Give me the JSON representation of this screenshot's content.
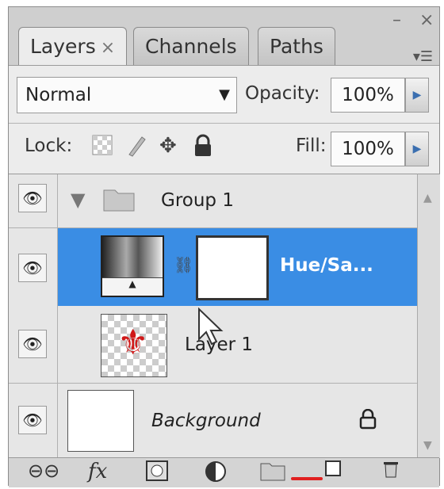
{
  "tabs": [
    {
      "label": "Layers",
      "close": "×"
    },
    {
      "label": "Channels"
    },
    {
      "label": "Paths"
    }
  ],
  "window_controls": {
    "minimize": "–",
    "close": "×",
    "menu": "▾☰"
  },
  "blend_mode": "Normal",
  "opacity": {
    "label": "Opacity:",
    "value": "100%"
  },
  "lock": {
    "label": "Lock:"
  },
  "fill": {
    "label": "Fill:",
    "value": "100%"
  },
  "layers": [
    {
      "name": "Group 1",
      "type": "group"
    },
    {
      "name": "Hue/Sa...",
      "type": "adjustment",
      "selected": true
    },
    {
      "name": "Layer 1",
      "type": "pixel"
    },
    {
      "name": "Background",
      "type": "background",
      "locked": true
    }
  ],
  "icons": {
    "eye": "eye-icon",
    "link": "link-layers-icon",
    "fx": "fx",
    "mask": "add-mask-icon",
    "adjustment": "adjustment-layer-icon",
    "folder": "new-group-icon",
    "new_layer": "new-layer-icon",
    "trash": "delete-icon"
  },
  "accent_color": "#3a8de4"
}
